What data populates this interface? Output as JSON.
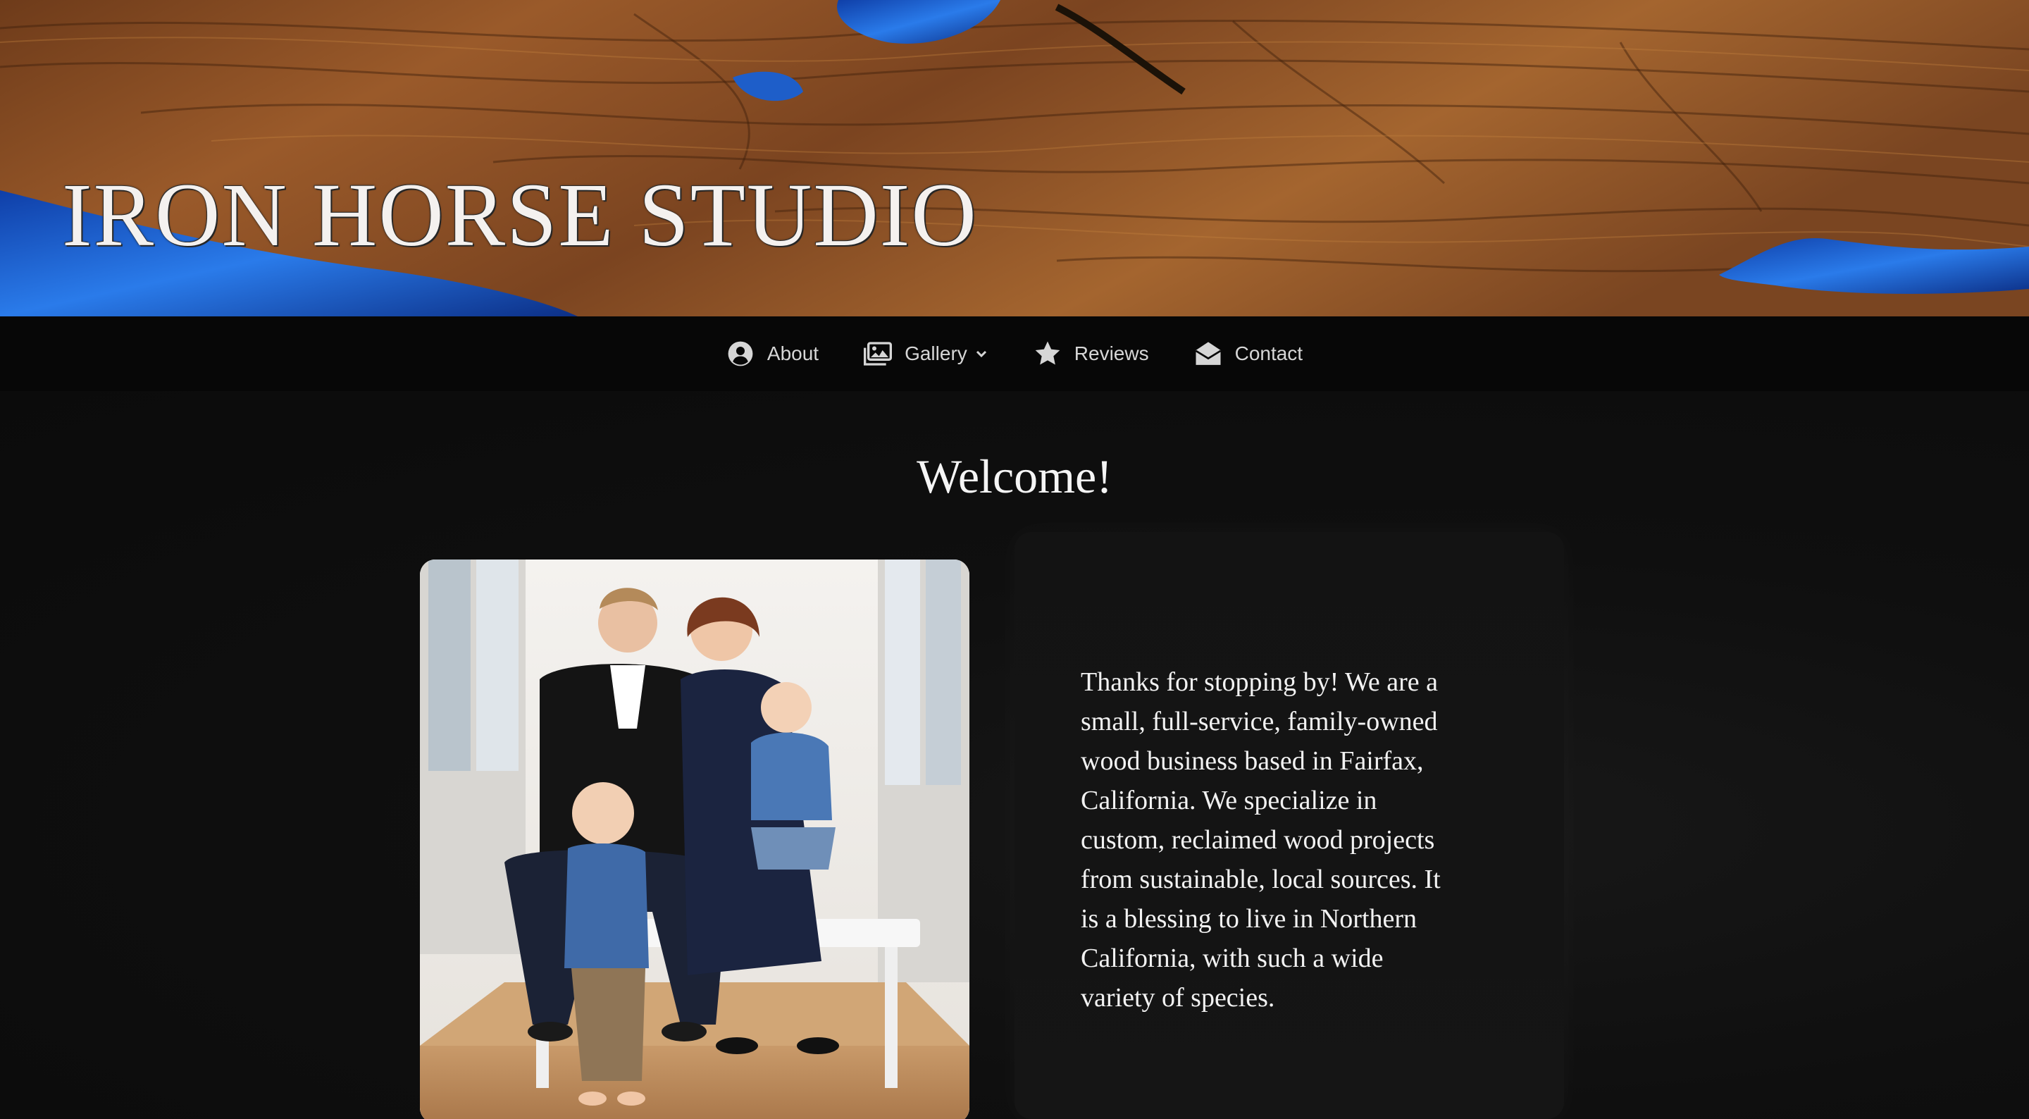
{
  "site": {
    "title": "IRON HORSE STUDIO"
  },
  "nav": {
    "items": [
      {
        "label": "About",
        "icon": "user-circle-icon"
      },
      {
        "label": "Gallery",
        "icon": "images-icon",
        "has_dropdown": true
      },
      {
        "label": "Reviews",
        "icon": "star-icon"
      },
      {
        "label": "Contact",
        "icon": "envelope-open-icon"
      }
    ]
  },
  "main": {
    "heading": "Welcome!",
    "photo_icon": "family-photo",
    "intro_text": "Thanks for stopping by! We are a small, full-service, family-owned wood business based in Fairfax, California. We specialize in custom, reclaimed wood projects from sustainable, local sources. It is a blessing to live in Northern California, with such a wide variety of species."
  },
  "colors": {
    "background": "#0b0b0b",
    "nav_background": "#070707",
    "nav_text": "#d6d6d6",
    "wood": "#8b4f24",
    "resin_blue": "#1a5fd0",
    "text": "#f2f2f2"
  }
}
